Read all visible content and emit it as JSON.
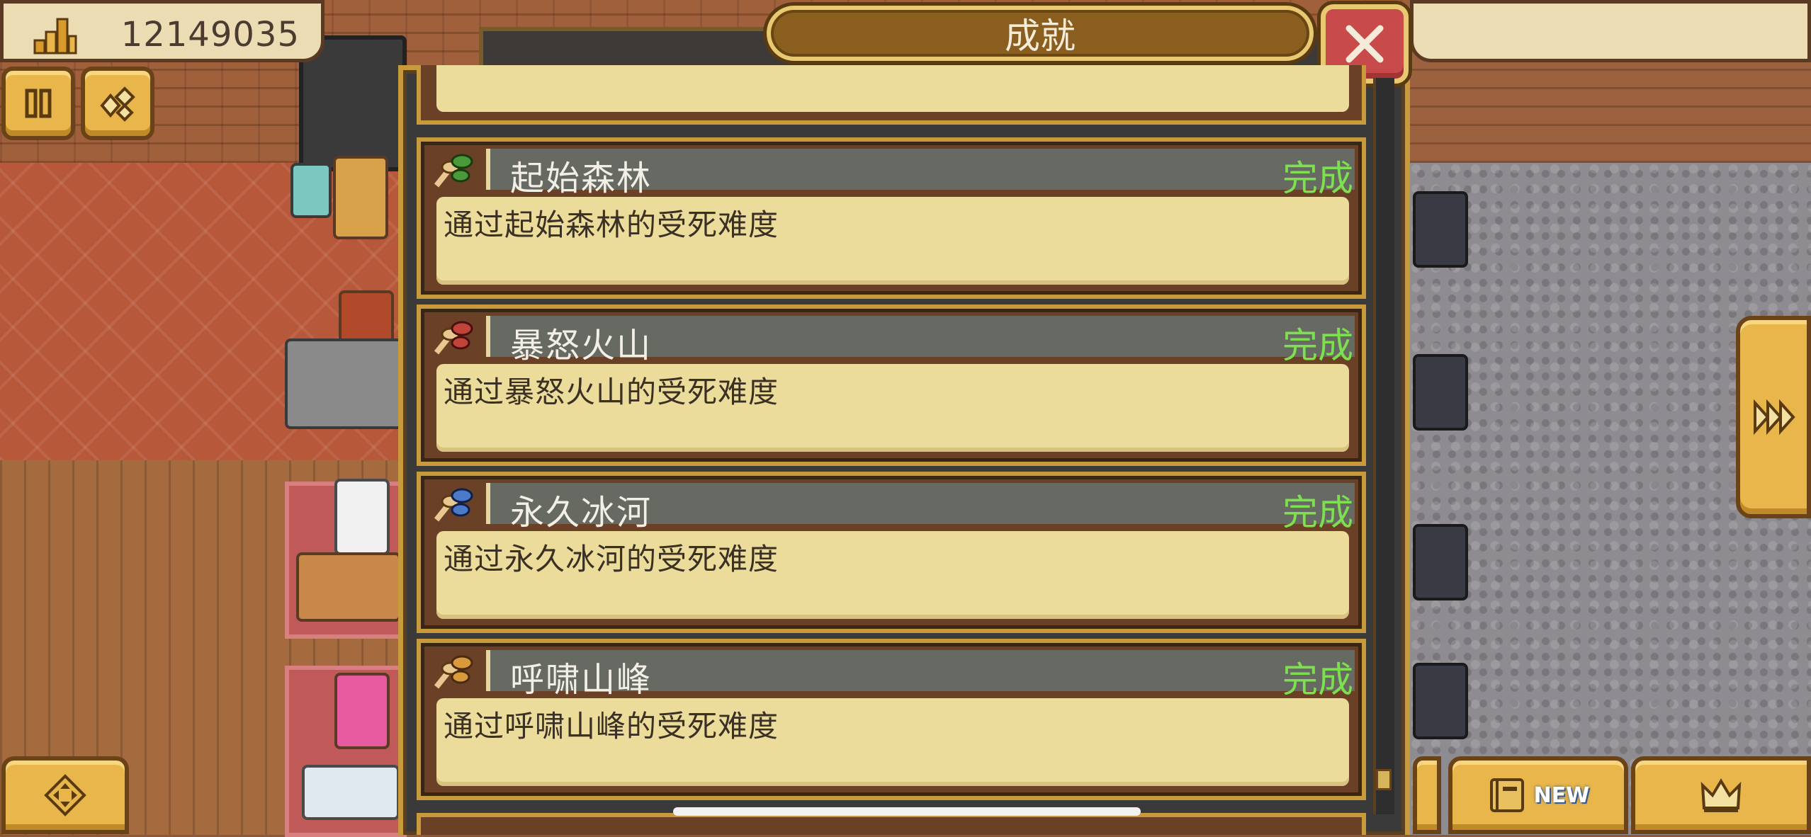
{
  "hud": {
    "gold_value": "12149035",
    "gold_icon": "gold-coins-icon",
    "pause_icon": "pause-icon",
    "gems_icon": "gems-icon",
    "dpad_icon": "dpad-icon",
    "journal_badge": "NEW",
    "journal_icon": "journal-icon",
    "crown_icon": "crown-icon",
    "forward_icon": "fast-forward-icon"
  },
  "modal": {
    "title": "成就",
    "close_icon": "close-icon",
    "items": [
      {
        "icon": "leaf-icon",
        "icon_color": "#4a9a3a",
        "title": "起始森林",
        "status": "完成",
        "description": "通过起始森林的受死难度"
      },
      {
        "icon": "leaf-icon",
        "icon_color": "#c0443a",
        "title": "暴怒火山",
        "status": "完成",
        "description": "通过暴怒火山的受死难度"
      },
      {
        "icon": "leaf-icon",
        "icon_color": "#4a7ac8",
        "title": "永久冰河",
        "status": "完成",
        "description": "通过永久冰河的受死难度"
      },
      {
        "icon": "leaf-icon",
        "icon_color": "#d89a3a",
        "title": "呼啸山峰",
        "status": "完成",
        "description": "通过呼啸山峰的受死难度"
      }
    ]
  },
  "colors": {
    "status_complete": "#7de04e",
    "panel_gold": "#c79b3c",
    "button_gold": "#e8b64a"
  }
}
